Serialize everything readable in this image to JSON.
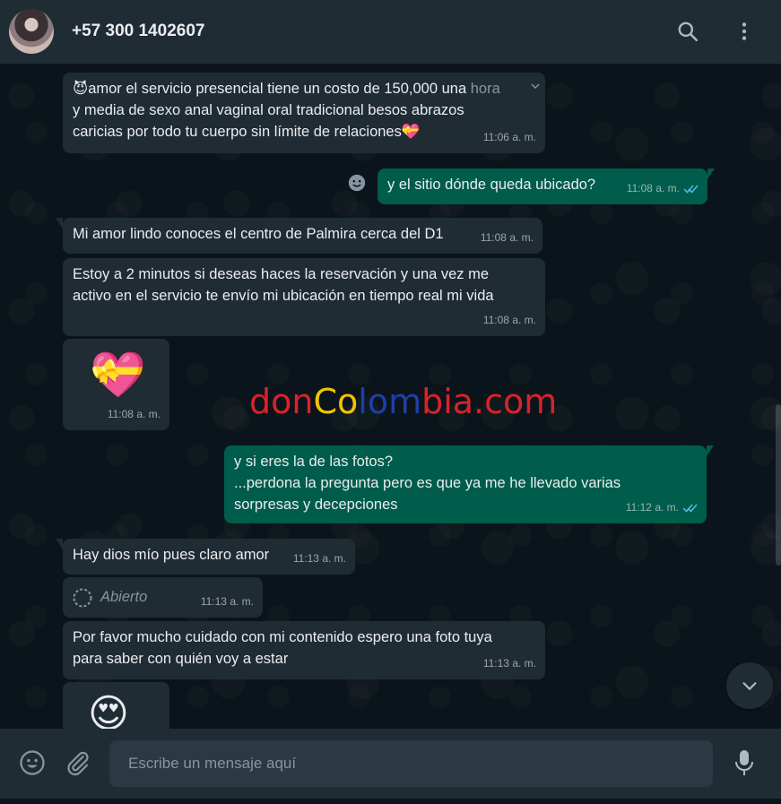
{
  "header": {
    "contact_name": "+57 300 1402607",
    "icons": [
      "search-icon",
      "menu-icon"
    ]
  },
  "messages": [
    {
      "dir": "in",
      "emoji_prefix": "😈",
      "text": "amor el servicio presencial tiene un costo de 150,000 una ",
      "highlight": "hora",
      "text2": "\ny media de sexo anal vaginal oral tradicional besos abrazos\ncaricias por todo tu cuerpo sin límite de relaciones",
      "emoji_suffix": "💝",
      "time": "11:06 a. m."
    },
    {
      "dir": "out",
      "text": "y el sitio dónde queda ubicado?",
      "time": "11:08 a. m."
    },
    {
      "dir": "in",
      "text": "Mi amor lindo conoces el centro de Palmira cerca del D1",
      "time": "11:08 a. m."
    },
    {
      "dir": "in",
      "text": "Estoy a 2 minutos si deseas haces la reservación y una vez me\nactivo en el servicio te envío mi ubicación en tiempo real mi vida",
      "time": "11:08 a. m."
    },
    {
      "dir": "in",
      "sticker": "💝",
      "time": "11:08 a. m."
    },
    {
      "dir": "out",
      "text": "y si eres la de las fotos?\n...perdona la pregunta pero es que ya me he llevado varias\nsorpresas y decepciones",
      "time": "11:12 a. m."
    },
    {
      "dir": "in",
      "text": "Hay dios mío pues claro amor",
      "time": "11:13 a. m."
    },
    {
      "dir": "in",
      "text": "Abierto",
      "time": "11:13 a. m.",
      "kind": "view-once-opened"
    },
    {
      "dir": "in",
      "text": "Por favor mucho cuidado con mi contenido espero una foto tuya\npara saber con quién voy a estar",
      "time": "11:13 a. m."
    },
    {
      "dir": "in",
      "sticker": "😍"
    }
  ],
  "watermark": {
    "parts": [
      {
        "text": "don",
        "color": "#d8232a"
      },
      {
        "text": "Co",
        "color": "#f2c500"
      },
      {
        "text": "lom",
        "color": "#1e3fa8"
      },
      {
        "text": "bia.com",
        "color": "#d8232a"
      }
    ]
  },
  "composer": {
    "placeholder": "Escribe un mensaje aquí"
  },
  "colors": {
    "header_bg": "#202c33",
    "chat_bg": "#0b141a",
    "incoming_bubble": "#202c33",
    "outgoing_bubble": "#005c4b",
    "read_ticks": "#53bdeb"
  }
}
